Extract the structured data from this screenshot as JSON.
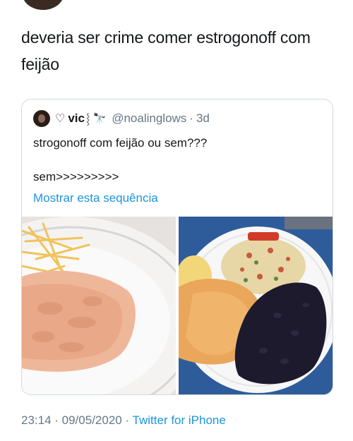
{
  "tweet": {
    "text": "deveria ser crime comer estrogonoff com feijão",
    "timestamp": "23:14 · 09/05/2020 · ",
    "source": "Twitter for iPhone"
  },
  "quoted_tweet": {
    "display_name": "vic",
    "name_emoji": "⸾ 🔭",
    "handle": "@noalinglows",
    "separator": "·",
    "time": "3d",
    "body": "strogonoff com feijão ou sem???\n\nsem>>>>>>>>>",
    "show_thread": "Mostrar esta sequência"
  },
  "icons": {
    "heart": "heart-outline-icon",
    "telescope": "telescope-icon"
  },
  "colors": {
    "link": "#1b95e0",
    "secondary_text": "#657786",
    "border": "#cfd9de"
  }
}
